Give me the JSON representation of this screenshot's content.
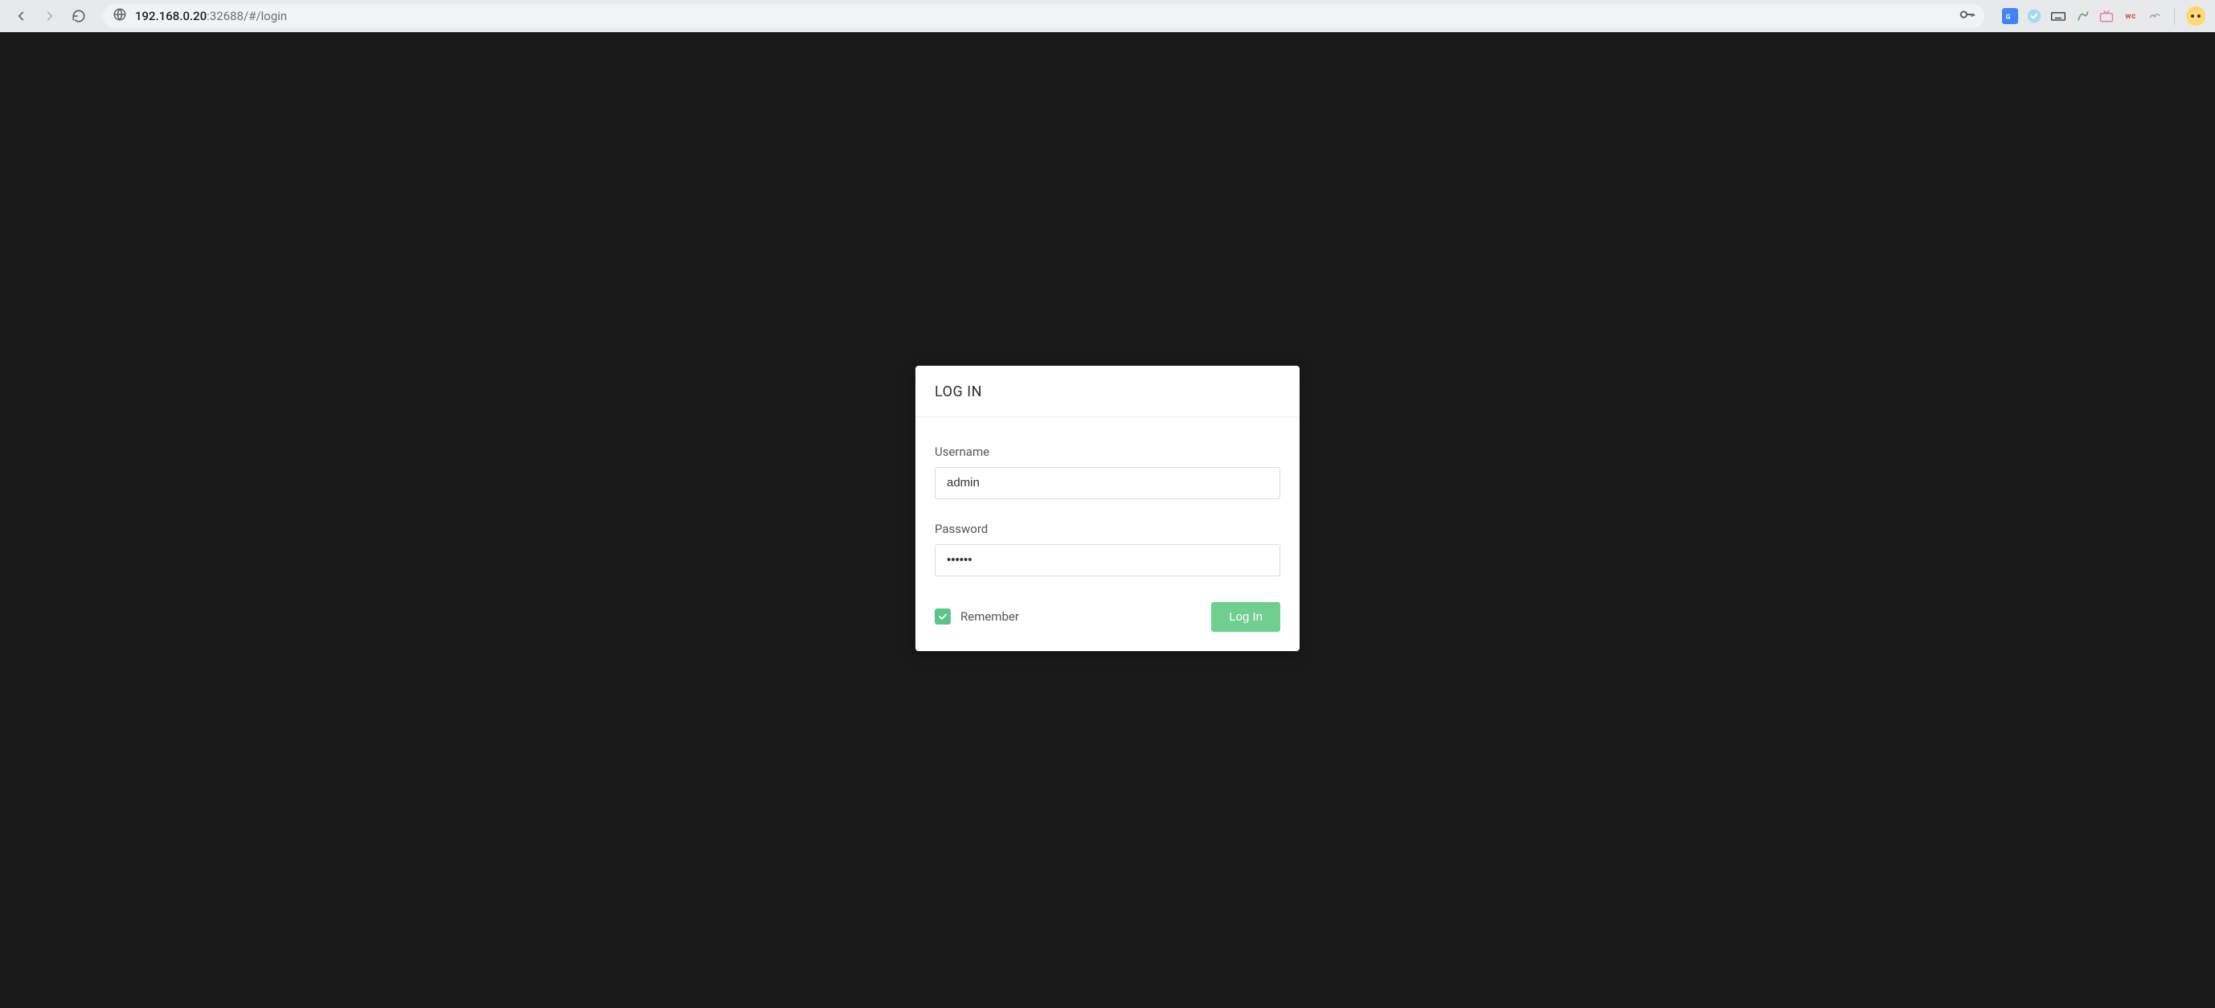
{
  "browser": {
    "url_host": "192.168.0.20",
    "url_rest": ":32688/#/login"
  },
  "login": {
    "title": "LOG IN",
    "username_label": "Username",
    "username_value": "admin",
    "password_label": "Password",
    "password_value": "••••••",
    "remember_label": "Remember",
    "remember_checked": true,
    "submit_label": "Log In"
  },
  "extensions": {
    "wc_label": "wc"
  },
  "colors": {
    "accent": "#6fcf8f",
    "card_bg": "#ffffff",
    "page_bg": "#1a1a1a"
  }
}
